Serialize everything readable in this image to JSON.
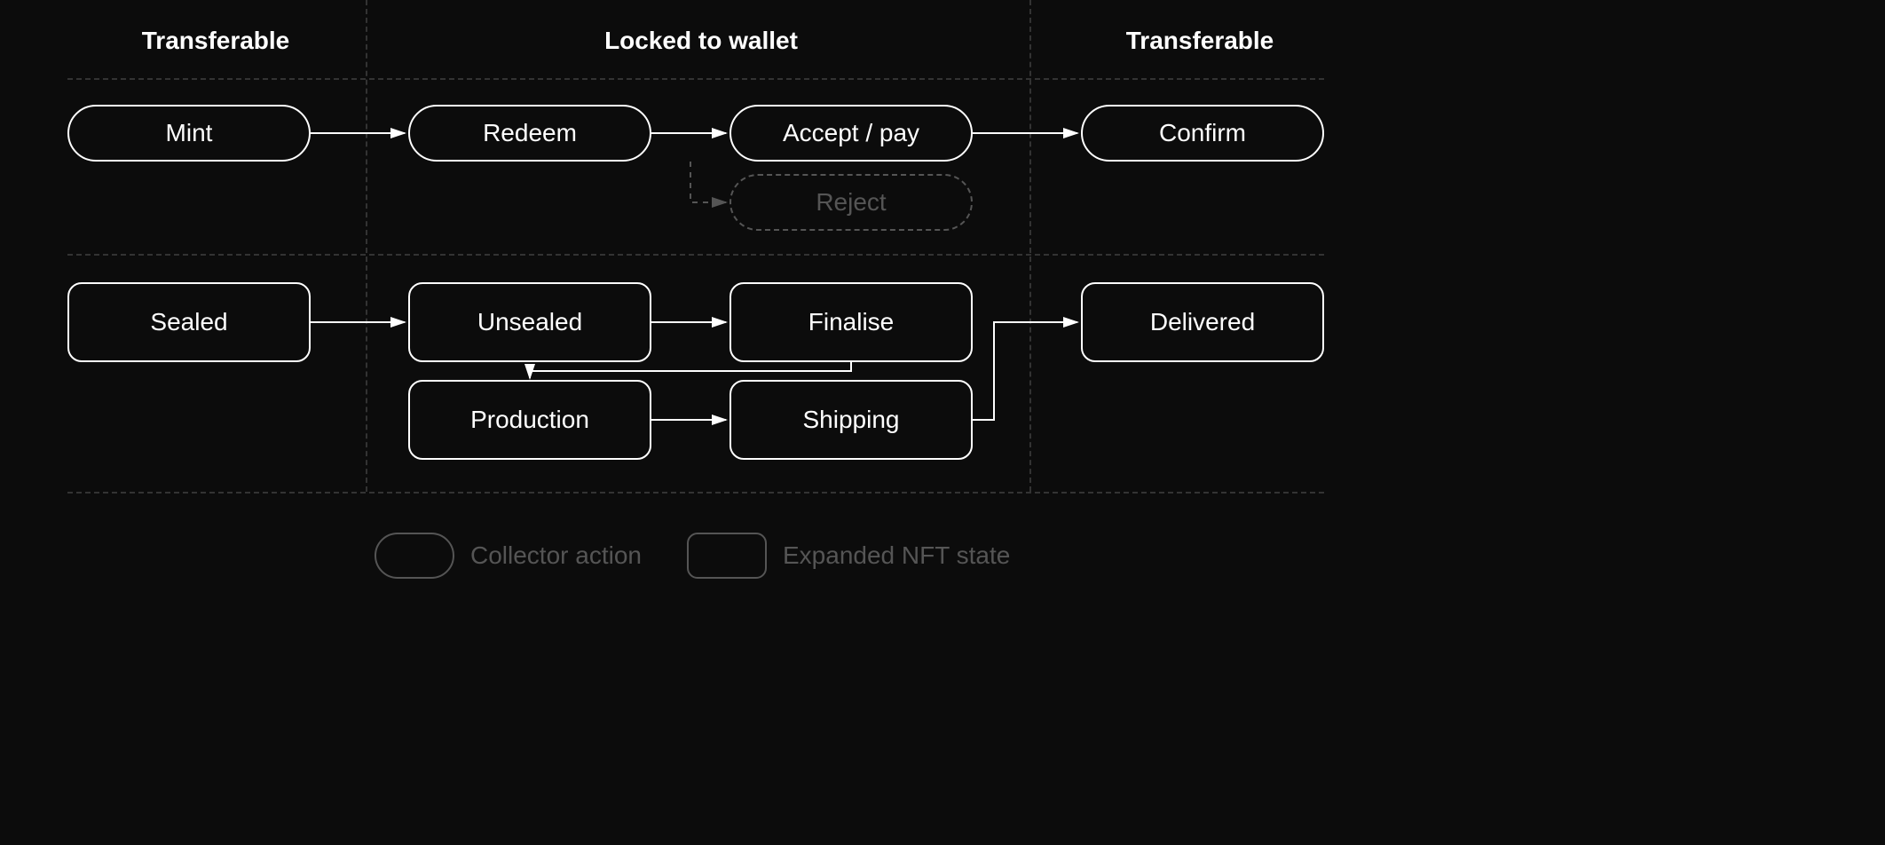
{
  "headers": {
    "col1": "Transferable",
    "col2": "Locked to wallet",
    "col3": "Transferable"
  },
  "actions": {
    "mint": "Mint",
    "redeem": "Redeem",
    "accept": "Accept / pay",
    "reject": "Reject",
    "confirm": "Confirm"
  },
  "states": {
    "sealed": "Sealed",
    "unsealed": "Unsealed",
    "finalise": "Finalise",
    "production": "Production",
    "shipping": "Shipping",
    "delivered": "Delivered"
  },
  "legend": {
    "collector": "Collector action",
    "nftstate": "Expanded NFT state"
  }
}
